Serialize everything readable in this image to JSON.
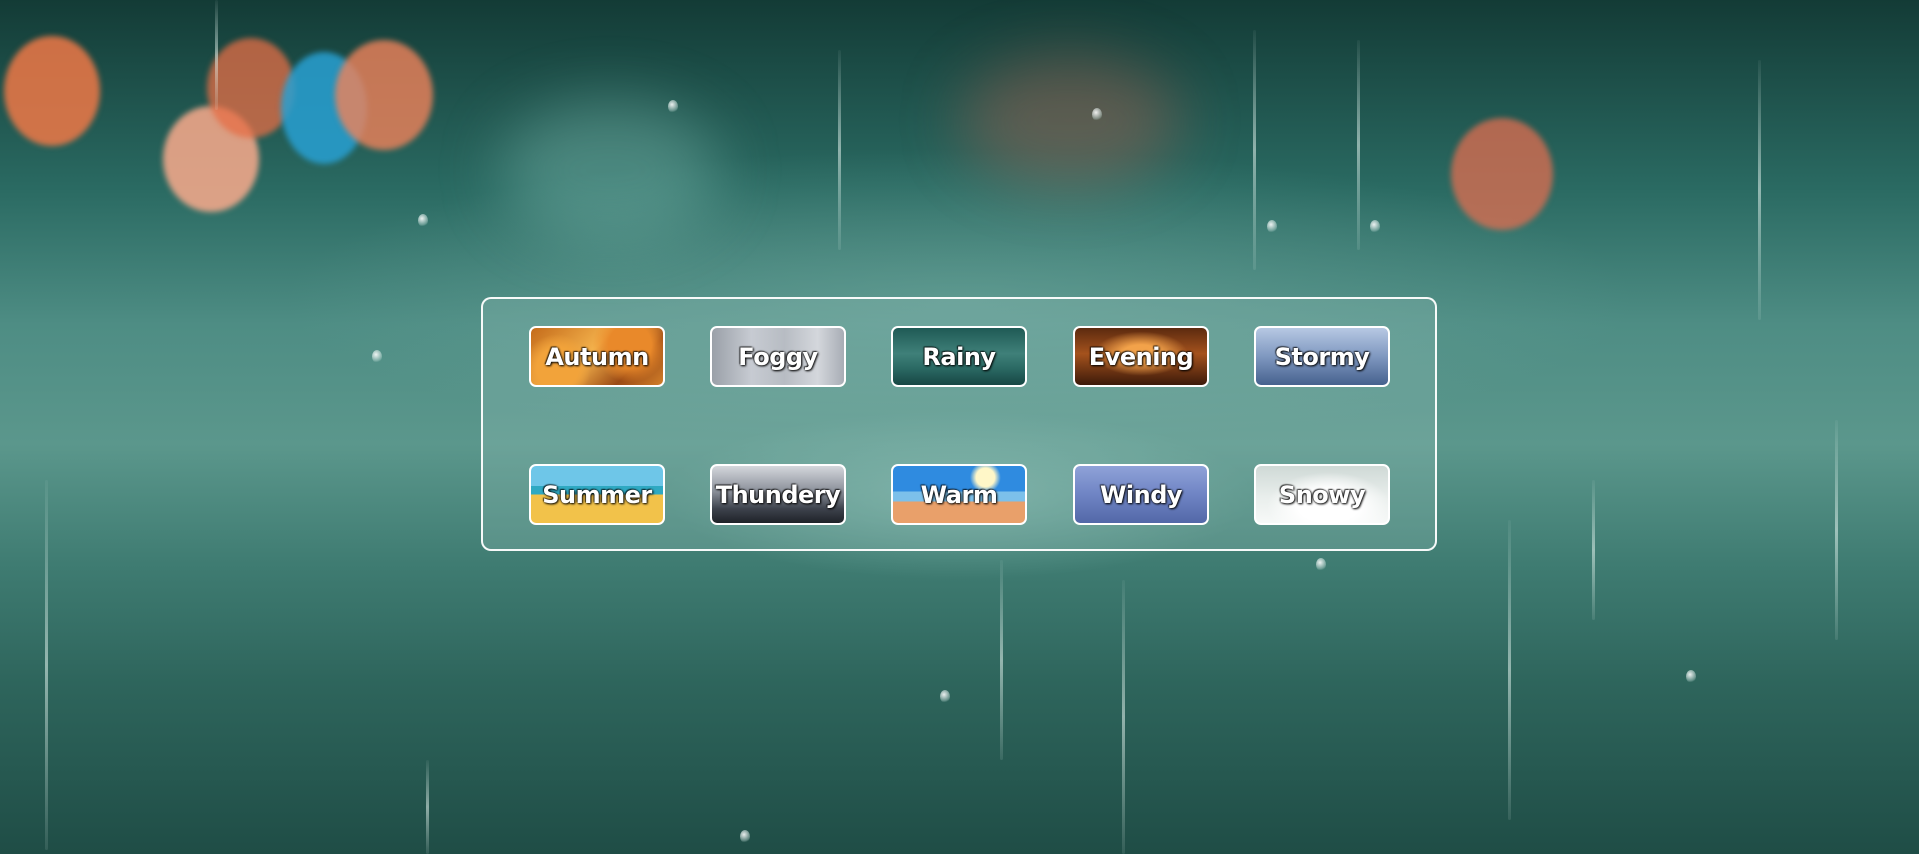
{
  "weather_options": [
    {
      "label": "Autumn",
      "bg": "autumn"
    },
    {
      "label": "Foggy",
      "bg": "foggy"
    },
    {
      "label": "Rainy",
      "bg": "rainy"
    },
    {
      "label": "Evening",
      "bg": "evening"
    },
    {
      "label": "Stormy",
      "bg": "stormy"
    },
    {
      "label": "Summer",
      "bg": "summer"
    },
    {
      "label": "Thundery",
      "bg": "thundery"
    },
    {
      "label": "Warm",
      "bg": "warm"
    },
    {
      "label": "Windy",
      "bg": "windy"
    },
    {
      "label": "Snowy",
      "bg": "snowy"
    }
  ],
  "colors": {
    "panel_border": "#ffffff",
    "tile_border": "#ffffff",
    "background_teal": "#4e8d84"
  }
}
